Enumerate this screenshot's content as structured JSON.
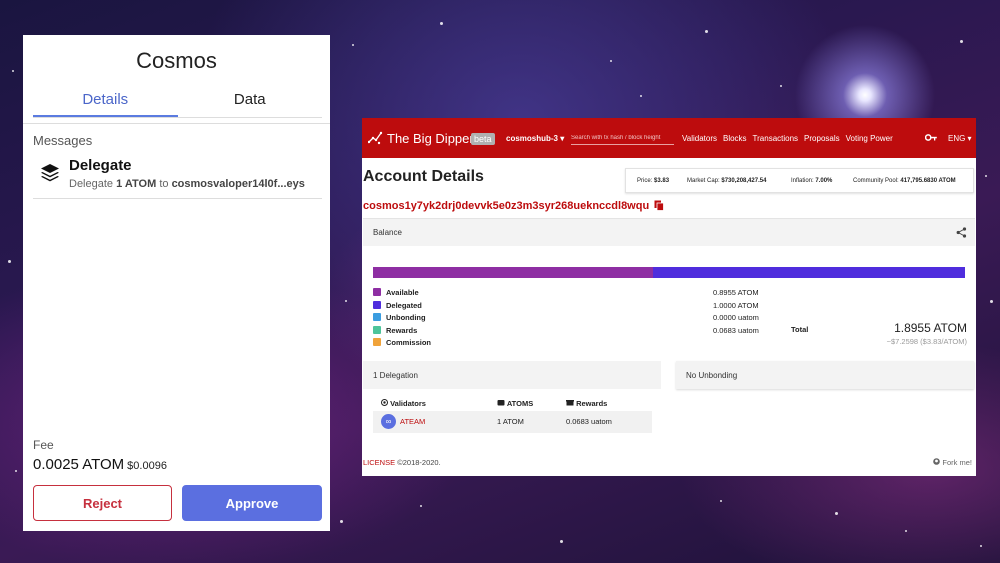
{
  "wallet": {
    "title": "Cosmos",
    "tabs": [
      {
        "label": "Details"
      },
      {
        "label": "Data"
      }
    ],
    "messages_label": "Messages",
    "message": {
      "title": "Delegate",
      "desc_prefix": "Delegate",
      "amount": "1 ATOM",
      "desc_to": "to",
      "validator": "cosmosvaloper14l0f...eys"
    },
    "fee_label": "Fee",
    "fee_value": "0.0025 ATOM",
    "fee_usd": "$0.0096",
    "reject_label": "Reject",
    "approve_label": "Approve"
  },
  "explorer": {
    "brand": "The Big Dipper",
    "beta": "beta",
    "chain": "cosmoshub-3 ▾",
    "search_placeholder": "Search with tx hash / block height",
    "nav": [
      "Validators",
      "Blocks",
      "Transactions",
      "Proposals",
      "Voting Power"
    ],
    "lang": "ENG ▾",
    "page_title": "Account Details",
    "price": {
      "price_label": "Price:",
      "price_value": "$3.83",
      "mcap_label": "Market Cap:",
      "mcap_value": "$730,208,427.54",
      "inflation_label": "Inflation:",
      "inflation_value": "7.00%",
      "pool_label": "Community Pool:",
      "pool_value": "417,795.6830 ATOM"
    },
    "address": "cosmos1y7yk2drj0devvk5e0z3m3syr268ueknccdl8wqu",
    "balance": {
      "label": "Balance",
      "items": [
        {
          "label": "Available",
          "value": "0.8955 ATOM",
          "color": "#8e2ea3"
        },
        {
          "label": "Delegated",
          "value": "1.0000 ATOM",
          "color": "#4f2ddd"
        },
        {
          "label": "Unbonding",
          "value": "0.0000 uatom",
          "color": "#3b9de0"
        },
        {
          "label": "Rewards",
          "value": "0.0683 uatom",
          "color": "#4dc49a"
        },
        {
          "label": "Commission",
          "value": "",
          "color": "#f0a33a"
        }
      ],
      "bar_fractions": {
        "available": 0.4725,
        "delegated": 0.5275
      },
      "total_label": "Total",
      "total_value": "1.8955 ATOM",
      "total_usd": "~$7.2598 ($3.83/ATOM)"
    },
    "delegations": {
      "label": "1 Delegation",
      "headers": [
        "Validators",
        "ATOMS",
        "Rewards"
      ],
      "rows": [
        {
          "validator": "ATEAM",
          "atoms": "1 ATOM",
          "rewards": "0.0683 uatom"
        }
      ]
    },
    "unbonding_label": "No Unbonding",
    "footer": {
      "license": "LICENSE",
      "years": "©2018-2020.",
      "fork": "Fork me!"
    }
  }
}
